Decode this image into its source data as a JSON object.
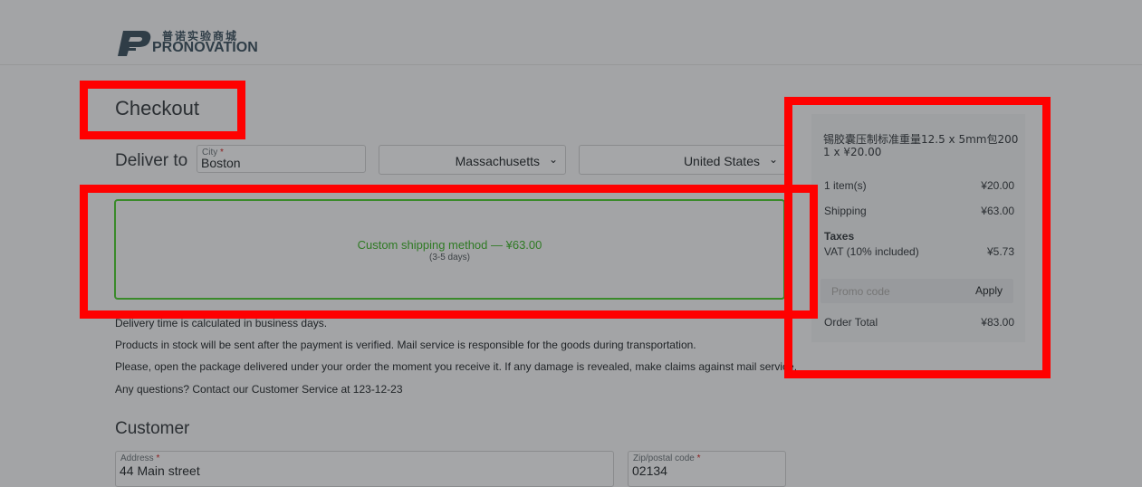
{
  "brand": {
    "name_cn": "普诺实验商城",
    "name_en": "PRONOVATION"
  },
  "checkout": {
    "title": "Checkout",
    "deliver_to_label": "Deliver to",
    "city": {
      "label": "City",
      "required_mark": "*",
      "value": "Boston"
    },
    "state": {
      "value": "Massachusetts"
    },
    "country": {
      "value": "United States"
    }
  },
  "shipping": {
    "method": "Custom shipping method — ¥63.00",
    "days": "(3-5 days)"
  },
  "info_lines": [
    "Delivery time is calculated in business days.",
    "Products in stock will be sent after the payment is verified. Mail service is responsible for the goods during transportation.",
    "Please, open the package delivered under your order the moment you receive it. If any damage is revealed, make claims against mail service.",
    "Any questions? Contact our Customer Service at 123-12-23"
  ],
  "customer": {
    "title": "Customer",
    "address": {
      "label": "Address",
      "required_mark": "*",
      "value": "44 Main street"
    },
    "zip": {
      "label": "Zip/postal code",
      "required_mark": "*",
      "value": "02134"
    }
  },
  "summary": {
    "product_name": "锡胶囊压制标准重量12.5 x 5mm包200",
    "product_qty": "1 x ¥20.00",
    "items_label": "1 item(s)",
    "items_value": "¥20.00",
    "shipping_label": "Shipping",
    "shipping_value": "¥63.00",
    "taxes_label": "Taxes",
    "vat_label": "VAT (10% included)",
    "vat_value": "¥5.73",
    "promo_placeholder": "Promo code",
    "apply_label": "Apply",
    "total_label": "Order Total",
    "total_value": "¥83.00"
  },
  "colors": {
    "highlight": "#ff0000",
    "shipping_selected": "#3a8a2a",
    "page_overlay": "#a3a4a6"
  },
  "icons": {
    "select_chevron": "chevron-down-icon",
    "logo": "pronovation-logo-icon"
  }
}
